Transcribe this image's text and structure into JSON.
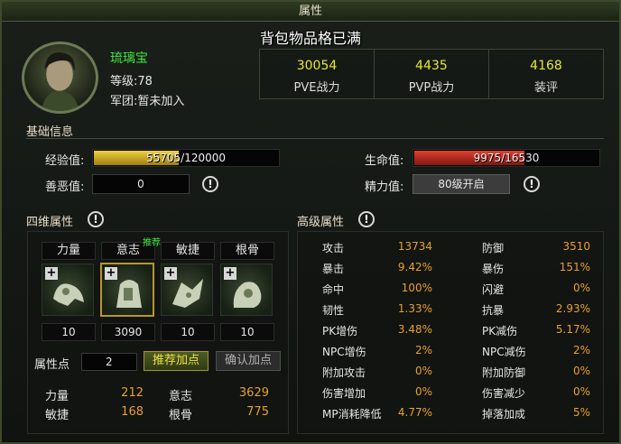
{
  "window": {
    "title": "属性"
  },
  "toast": "背包物品格已满",
  "player": {
    "name": "琉璃宝",
    "level": "等级:78",
    "guild": "军团:暂未加入"
  },
  "power": [
    {
      "value": "30054",
      "label": "PVE战力"
    },
    {
      "value": "4435",
      "label": "PVP战力"
    },
    {
      "value": "4168",
      "label": "装评"
    }
  ],
  "basic": {
    "title": "基础信息",
    "exp_label": "经验值:",
    "exp_text": "55705/120000",
    "exp_fraction": 0.46,
    "hp_label": "生命值:",
    "hp_text": "9975/16530",
    "hp_fraction": 0.6,
    "karma_label": "善恶值:",
    "karma_value": "0",
    "energy_label": "精力值:",
    "energy_value": "80级开启"
  },
  "four": {
    "title": "四维属性",
    "headers": [
      "力量",
      "意志",
      "敏捷",
      "根骨"
    ],
    "values": [
      "10",
      "3090",
      "10",
      "10"
    ],
    "recommend_badge": "推荐",
    "points_label": "属性点",
    "points_value": "2",
    "recommend_button": "推荐加点",
    "confirm_button": "确认加点",
    "summary": [
      {
        "label": "力量",
        "value": "212"
      },
      {
        "label": "意志",
        "value": "3629"
      },
      {
        "label": "敏捷",
        "value": "168"
      },
      {
        "label": "根骨",
        "value": "775"
      }
    ]
  },
  "advanced": {
    "title": "高级属性",
    "rows": [
      [
        {
          "label": "攻击",
          "value": "13734"
        },
        {
          "label": "防御",
          "value": "3510"
        }
      ],
      [
        {
          "label": "暴击",
          "value": "9.42%"
        },
        {
          "label": "暴伤",
          "value": "151%"
        }
      ],
      [
        {
          "label": "命中",
          "value": "100%"
        },
        {
          "label": "闪避",
          "value": "0%"
        }
      ],
      [
        {
          "label": "韧性",
          "value": "1.33%"
        },
        {
          "label": "抗暴",
          "value": "2.93%"
        }
      ],
      [
        {
          "label": "PK增伤",
          "value": "3.48%"
        },
        {
          "label": "PK减伤",
          "value": "5.17%"
        }
      ],
      [
        {
          "label": "NPC增伤",
          "value": "2%"
        },
        {
          "label": "NPC减伤",
          "value": "2%"
        }
      ],
      [
        {
          "label": "附加攻击",
          "value": "0%"
        },
        {
          "label": "附加防御",
          "value": "0%"
        }
      ],
      [
        {
          "label": "伤害增加",
          "value": "0%"
        },
        {
          "label": "伤害减少",
          "value": "0%"
        }
      ],
      [
        {
          "label": "MP消耗降低",
          "value": "4.77%"
        },
        {
          "label": "掉落加成",
          "value": "5%"
        }
      ]
    ]
  },
  "colors": {
    "exp": "#e8c020",
    "hp": "#c02820",
    "accent": "#e8e830",
    "value": "#e8a030"
  }
}
